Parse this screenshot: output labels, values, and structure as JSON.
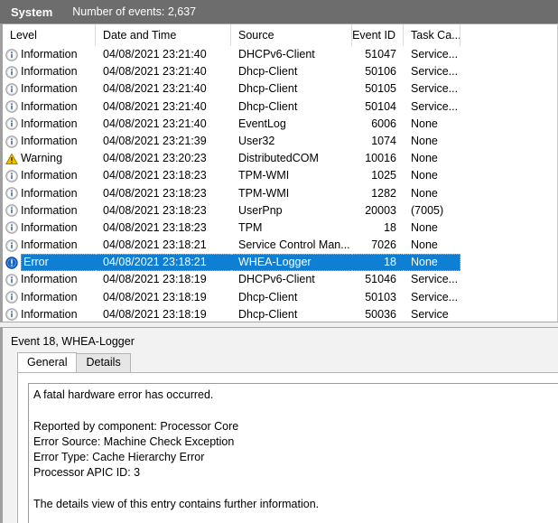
{
  "log_header": {
    "log_name": "System",
    "event_count_label": "Number of events: 2,637"
  },
  "events_table": {
    "columns": [
      {
        "key": "level",
        "label": "Level",
        "align": "left"
      },
      {
        "key": "date",
        "label": "Date and Time",
        "align": "left"
      },
      {
        "key": "source",
        "label": "Source",
        "align": "left"
      },
      {
        "key": "event_id",
        "label": "Event ID",
        "align": "right"
      },
      {
        "key": "task",
        "label": "Task Ca...",
        "align": "left"
      }
    ],
    "rows": [
      {
        "icon": "information-icon",
        "level": "Information",
        "date": "04/08/2021 23:21:40",
        "source": "DHCPv6-Client",
        "event_id": "51047",
        "task": "Service...",
        "selected": false
      },
      {
        "icon": "information-icon",
        "level": "Information",
        "date": "04/08/2021 23:21:40",
        "source": "Dhcp-Client",
        "event_id": "50106",
        "task": "Service...",
        "selected": false
      },
      {
        "icon": "information-icon",
        "level": "Information",
        "date": "04/08/2021 23:21:40",
        "source": "Dhcp-Client",
        "event_id": "50105",
        "task": "Service...",
        "selected": false
      },
      {
        "icon": "information-icon",
        "level": "Information",
        "date": "04/08/2021 23:21:40",
        "source": "Dhcp-Client",
        "event_id": "50104",
        "task": "Service...",
        "selected": false
      },
      {
        "icon": "information-icon",
        "level": "Information",
        "date": "04/08/2021 23:21:40",
        "source": "EventLog",
        "event_id": "6006",
        "task": "None",
        "selected": false
      },
      {
        "icon": "information-icon",
        "level": "Information",
        "date": "04/08/2021 23:21:39",
        "source": "User32",
        "event_id": "1074",
        "task": "None",
        "selected": false
      },
      {
        "icon": "warning-icon",
        "level": "Warning",
        "date": "04/08/2021 23:20:23",
        "source": "DistributedCOM",
        "event_id": "10016",
        "task": "None",
        "selected": false
      },
      {
        "icon": "information-icon",
        "level": "Information",
        "date": "04/08/2021 23:18:23",
        "source": "TPM-WMI",
        "event_id": "1025",
        "task": "None",
        "selected": false
      },
      {
        "icon": "information-icon",
        "level": "Information",
        "date": "04/08/2021 23:18:23",
        "source": "TPM-WMI",
        "event_id": "1282",
        "task": "None",
        "selected": false
      },
      {
        "icon": "information-icon",
        "level": "Information",
        "date": "04/08/2021 23:18:23",
        "source": "UserPnp",
        "event_id": "20003",
        "task": "(7005)",
        "selected": false
      },
      {
        "icon": "information-icon",
        "level": "Information",
        "date": "04/08/2021 23:18:23",
        "source": "TPM",
        "event_id": "18",
        "task": "None",
        "selected": false
      },
      {
        "icon": "information-icon",
        "level": "Information",
        "date": "04/08/2021 23:18:21",
        "source": "Service Control Man...",
        "event_id": "7026",
        "task": "None",
        "selected": false
      },
      {
        "icon": "error-icon",
        "level": "Error",
        "date": "04/08/2021 23:18:21",
        "source": "WHEA-Logger",
        "event_id": "18",
        "task": "None",
        "selected": true
      },
      {
        "icon": "information-icon",
        "level": "Information",
        "date": "04/08/2021 23:18:19",
        "source": "DHCPv6-Client",
        "event_id": "51046",
        "task": "Service...",
        "selected": false
      },
      {
        "icon": "information-icon",
        "level": "Information",
        "date": "04/08/2021 23:18:19",
        "source": "Dhcp-Client",
        "event_id": "50103",
        "task": "Service...",
        "selected": false
      },
      {
        "icon": "information-icon",
        "level": "Information",
        "date": "04/08/2021 23:18:19",
        "source": "Dhcp-Client",
        "event_id": "50036",
        "task": "Service",
        "selected": false
      }
    ]
  },
  "detail": {
    "title": "Event 18, WHEA-Logger",
    "tabs": [
      {
        "label": "General",
        "active": true
      },
      {
        "label": "Details",
        "active": false
      }
    ],
    "description_lines": [
      "A fatal hardware error has occurred.",
      "",
      "Reported by component: Processor Core",
      "Error Source: Machine Check Exception",
      "Error Type: Cache Hierarchy Error",
      "Processor APIC ID: 3",
      "",
      "The details view of this entry contains further information."
    ]
  },
  "colors": {
    "header_bar": "#6d6d6d",
    "selection": "#0f7fd4",
    "selection_focus_outline": "#f0c000",
    "information_icon": "#3b6ea5",
    "warning_icon": "#f0c000",
    "error_icon": "#1565c0"
  }
}
